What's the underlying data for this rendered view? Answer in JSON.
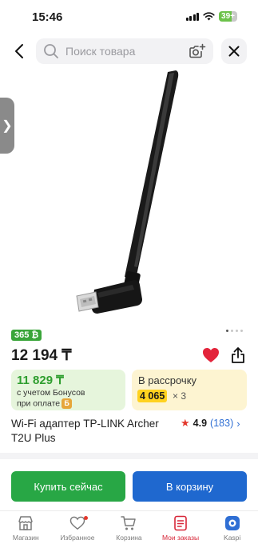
{
  "status": {
    "time": "15:46",
    "battery": "39+"
  },
  "search": {
    "placeholder": "Поиск товара"
  },
  "product": {
    "badge": "365 ₿",
    "price": "12 194 ₸",
    "bonus": {
      "price": "11 829 ₸",
      "line1": "с учетом Бонусов",
      "line2": "при оплате"
    },
    "installment": {
      "label": "В рассрочку",
      "amount": "4 065",
      "multiplier": "× 3"
    },
    "title": "Wi-Fi адаптер TP-LINK Archer T2U Plus",
    "rating": {
      "value": "4.9",
      "count": "(183)"
    }
  },
  "actions": {
    "buy_now": "Купить сейчас",
    "add_to_cart": "В корзину"
  },
  "tabbar": {
    "items": [
      {
        "label": "Магазин",
        "icon": "shop-icon"
      },
      {
        "label": "Избранное",
        "icon": "heart-icon"
      },
      {
        "label": "Корзина",
        "icon": "cart-icon"
      },
      {
        "label": "Мои заказы",
        "icon": "orders-icon"
      },
      {
        "label": "Kaspi",
        "icon": "kaspi-icon"
      }
    ]
  },
  "colors": {
    "accent_red": "#d72638",
    "buy_green": "#28a745",
    "cart_blue": "#1f68cf",
    "installment_yellow": "#ffd21f"
  },
  "gallery": {
    "count": 4,
    "active": 1
  }
}
